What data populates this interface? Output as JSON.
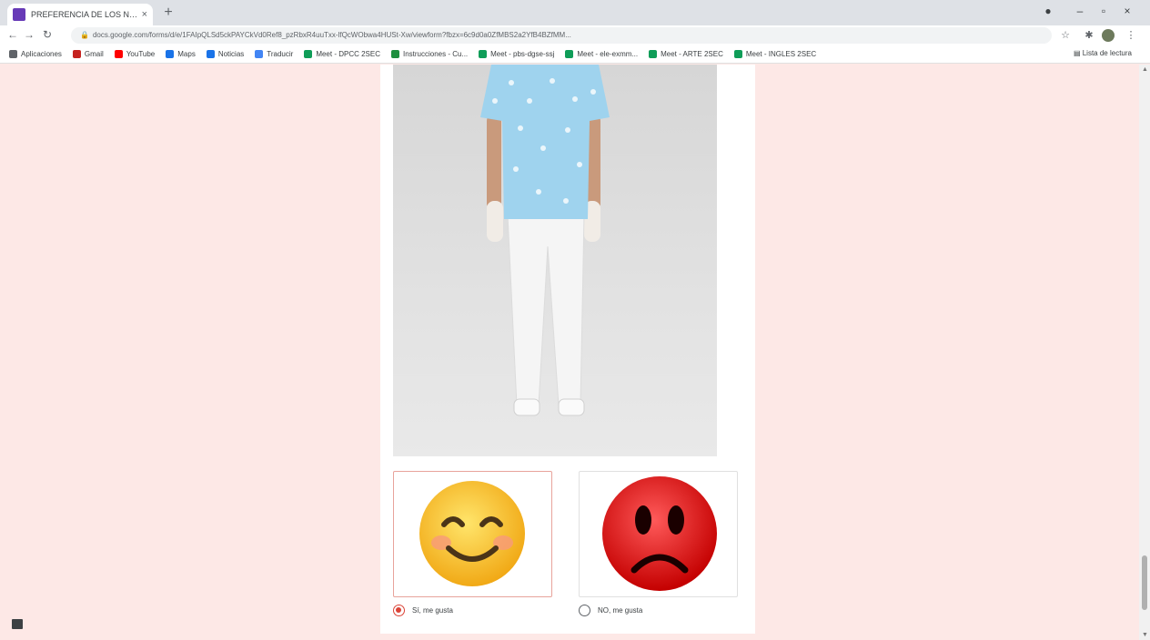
{
  "tab": {
    "title": "PREFERENCIA DE LOS NIÑOS Y ..."
  },
  "address": {
    "url": "docs.google.com/forms/d/e/1FAIpQLSd5ckPAYCkVd0Ref8_pzRbxR4uuTxx-lfQcWObwa4HUSt-Xw/viewform?fbzx=6c9d0a0ZfMBS2a2YfB4BZfMM..."
  },
  "bookmarks": [
    {
      "label": "Aplicaciones",
      "color": "#5f6368"
    },
    {
      "label": "Gmail",
      "color": "#c5221f"
    },
    {
      "label": "YouTube",
      "color": "#ff0000"
    },
    {
      "label": "Maps",
      "color": "#1a73e8"
    },
    {
      "label": "Noticias",
      "color": "#1a73e8"
    },
    {
      "label": "Traducir",
      "color": "#4285f4"
    },
    {
      "label": "Meet - DPCC 2SEC",
      "color": "#0f9d58"
    },
    {
      "label": "Instrucciones - Cu...",
      "color": "#1e8e3e"
    },
    {
      "label": "Meet - pbs-dgse-ssj",
      "color": "#0f9d58"
    },
    {
      "label": "Meet - ele-exmm...",
      "color": "#0f9d58"
    },
    {
      "label": "Meet - ARTE 2SEC",
      "color": "#0f9d58"
    },
    {
      "label": "Meet - INGLES 2SEC",
      "color": "#0f9d58"
    }
  ],
  "reading_list": "Lista de lectura",
  "options": [
    {
      "label": "Sí, me gusta",
      "selected": true
    },
    {
      "label": "NO, me gusta",
      "selected": false
    }
  ]
}
